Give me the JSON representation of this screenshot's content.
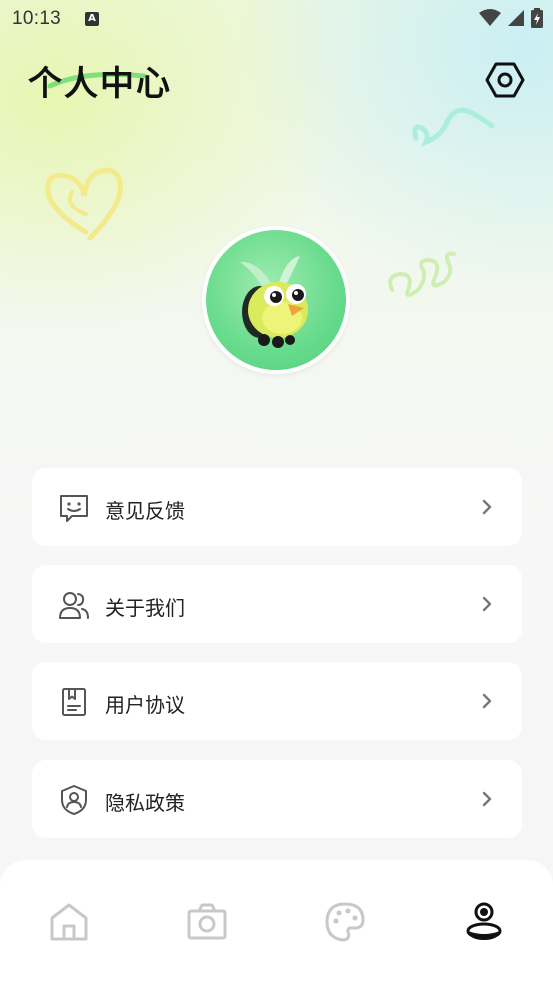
{
  "status_bar": {
    "time": "10:13",
    "notification_badge": "A"
  },
  "header": {
    "title": "个人中心",
    "settings_icon": "settings-hexagon-icon"
  },
  "profile": {
    "avatar_icon": "bird-mascot-avatar"
  },
  "menu": [
    {
      "label": "意见反馈",
      "icon": "feedback-icon"
    },
    {
      "label": "关于我们",
      "icon": "users-icon"
    },
    {
      "label": "用户协议",
      "icon": "agreement-icon"
    },
    {
      "label": "隐私政策",
      "icon": "privacy-shield-icon"
    }
  ],
  "tabbar": {
    "tabs": [
      {
        "icon": "home-icon",
        "active": false
      },
      {
        "icon": "camera-icon",
        "active": false
      },
      {
        "icon": "palette-icon",
        "active": false
      },
      {
        "icon": "profile-icon",
        "active": true
      }
    ]
  },
  "colors": {
    "accent": "#4fcf7b",
    "active_tab": "#111111",
    "inactive_tab": "#c8c8c8",
    "icon_gray": "#555555",
    "doodle_yellow": "#f3ea8c",
    "doodle_green": "#cfeeb3",
    "doodle_cyan": "#aaeee0"
  }
}
